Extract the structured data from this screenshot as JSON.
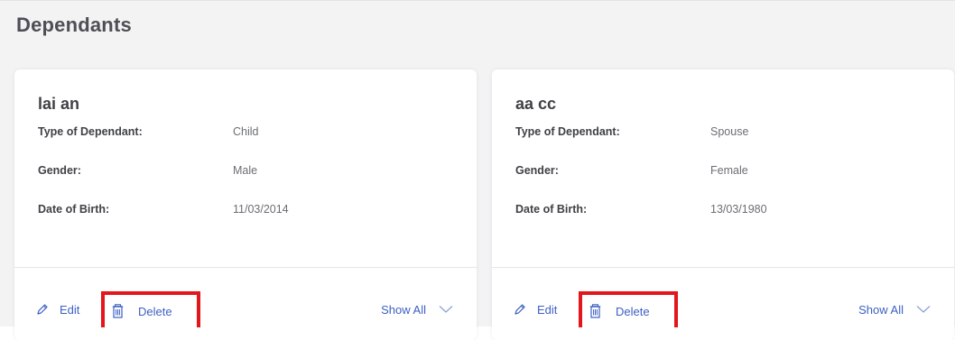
{
  "section": {
    "title": "Dependants"
  },
  "dependants": [
    {
      "name": "lai an",
      "fields": [
        {
          "label": "Type of Dependant:",
          "value": "Child"
        },
        {
          "label": "Gender:",
          "value": "Male"
        },
        {
          "label": "Date of Birth:",
          "value": "11/03/2014"
        }
      ],
      "actions": {
        "edit": "Edit",
        "delete": "Delete",
        "show_all": "Show All"
      }
    },
    {
      "name": "aa cc",
      "fields": [
        {
          "label": "Type of Dependant:",
          "value": "Spouse"
        },
        {
          "label": "Gender:",
          "value": "Female"
        },
        {
          "label": "Date of Birth:",
          "value": "13/03/1980"
        }
      ],
      "actions": {
        "edit": "Edit",
        "delete": "Delete",
        "show_all": "Show All"
      }
    }
  ],
  "icons": {
    "edit": "pencil-icon",
    "delete": "trash-icon",
    "expand": "chevron-down-icon"
  },
  "colors": {
    "link": "#3d5fc4",
    "highlight": "#e3161c",
    "panel_background": "#f3f3f4"
  }
}
